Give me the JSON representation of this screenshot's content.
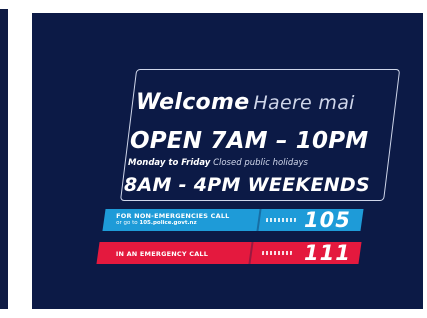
{
  "sign": {
    "welcome": "Welcome",
    "welcome_maori": "Haere mai",
    "open_hours": "OPEN 7AM – 10PM",
    "weekday_days": "Monday to Friday",
    "weekday_note": "Closed public holidays",
    "weekend_hours": "8AM - 4PM WEEKENDS"
  },
  "non_emergency": {
    "label": "FOR NON-EMERGENCIES CALL",
    "sub_prefix": "or go to",
    "url": "105.police.govt.nz",
    "number": "105"
  },
  "emergency": {
    "label": "IN AN EMERGENCY CALL",
    "number": "111"
  },
  "colors": {
    "panel": "#0c1a46",
    "non_emergency_bar": "#1e9bd8",
    "emergency_bar": "#e4193e"
  }
}
